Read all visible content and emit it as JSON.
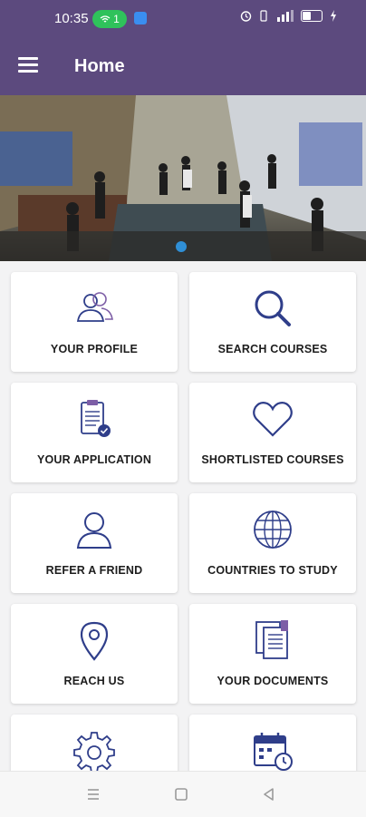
{
  "status_bar": {
    "time": "10:35",
    "hotspot_count": "1",
    "icons": [
      "hotspot-icon",
      "notification-icon",
      "alarm-icon",
      "vibrate-icon",
      "signal-icon",
      "battery-icon",
      "charging-icon"
    ]
  },
  "app_bar": {
    "title": "Home",
    "menu_icon": "hamburger-menu-icon"
  },
  "banner": {
    "image_description": "exhibition-hall-photo",
    "carousel_position": 1
  },
  "tiles": [
    {
      "label": "YOUR PROFILE",
      "icon": "users-icon"
    },
    {
      "label": "SEARCH COURSES",
      "icon": "search-icon"
    },
    {
      "label": "YOUR APPLICATION",
      "icon": "clipboard-check-icon"
    },
    {
      "label": "SHORTLISTED COURSES",
      "icon": "heart-icon"
    },
    {
      "label": "REFER A FRIEND",
      "icon": "user-icon"
    },
    {
      "label": "COUNTRIES TO STUDY",
      "icon": "globe-icon"
    },
    {
      "label": "REACH US",
      "icon": "location-pin-icon"
    },
    {
      "label": "YOUR DOCUMENTS",
      "icon": "documents-icon"
    },
    {
      "label": "",
      "icon": "gear-icon"
    },
    {
      "label": "",
      "icon": "calendar-clock-icon"
    }
  ],
  "nav_bar": {
    "buttons": [
      "menu-nav-icon",
      "home-nav-icon",
      "back-nav-icon"
    ]
  },
  "colors": {
    "primary": "#5c4a7e",
    "icon_stroke": "#2f3e8a",
    "background": "#f3f3f4",
    "card": "#ffffff",
    "hotspot": "#2fc25b",
    "carousel_dot": "#2f8fd6"
  }
}
